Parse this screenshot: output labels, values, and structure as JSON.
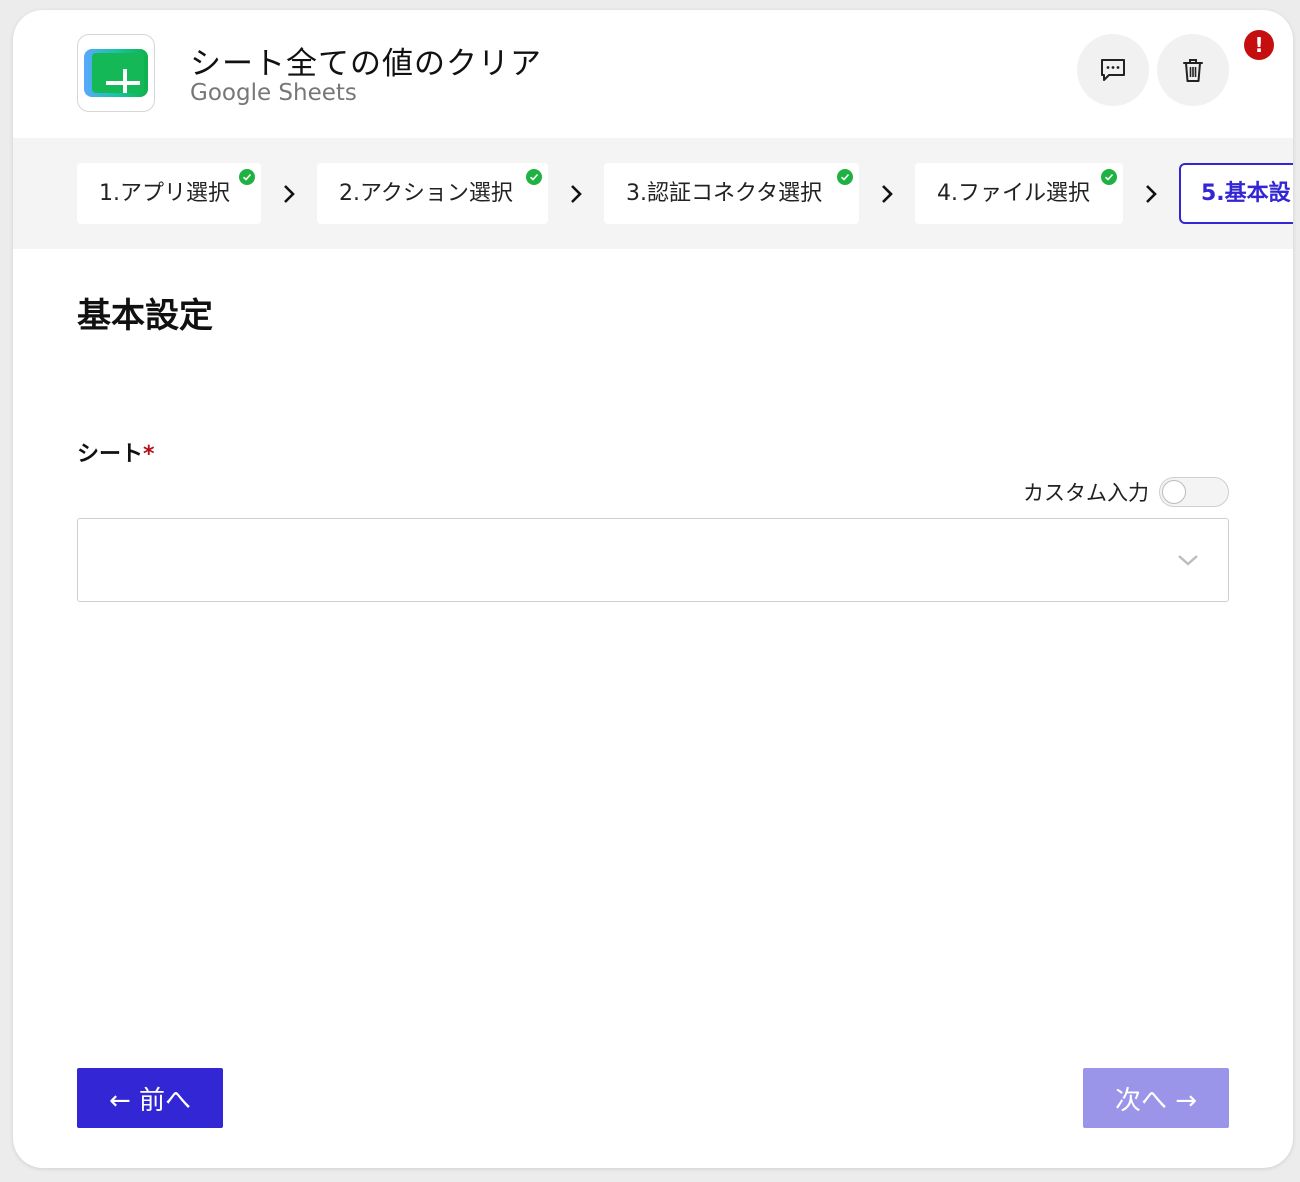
{
  "header": {
    "title": "シート全ての値のクリア",
    "subtitle": "Google Sheets",
    "app_icon": "google-sheets-icon",
    "comment_icon": "comment-icon",
    "delete_icon": "trash-icon",
    "alert_badge": "!"
  },
  "steps": [
    {
      "label": "1.アプリ選択",
      "completed": true
    },
    {
      "label": "2.アクション選択",
      "completed": true
    },
    {
      "label": "3.認証コネクタ選択",
      "completed": true
    },
    {
      "label": "4.ファイル選択",
      "completed": true
    },
    {
      "label": "5.基本設",
      "completed": false,
      "active": true
    }
  ],
  "section": {
    "title": "基本設定"
  },
  "sheet_field": {
    "label": "シート",
    "required_mark": "*",
    "custom_input_label": "カスタム入力",
    "custom_input_enabled": false,
    "value": ""
  },
  "footer": {
    "prev_label": "← 前へ",
    "next_label": "次へ →"
  },
  "colors": {
    "primary": "#3326d4",
    "primary_disabled": "#9b95ea",
    "success": "#1fb141",
    "danger": "#c40e10",
    "required": "#b5101a"
  }
}
